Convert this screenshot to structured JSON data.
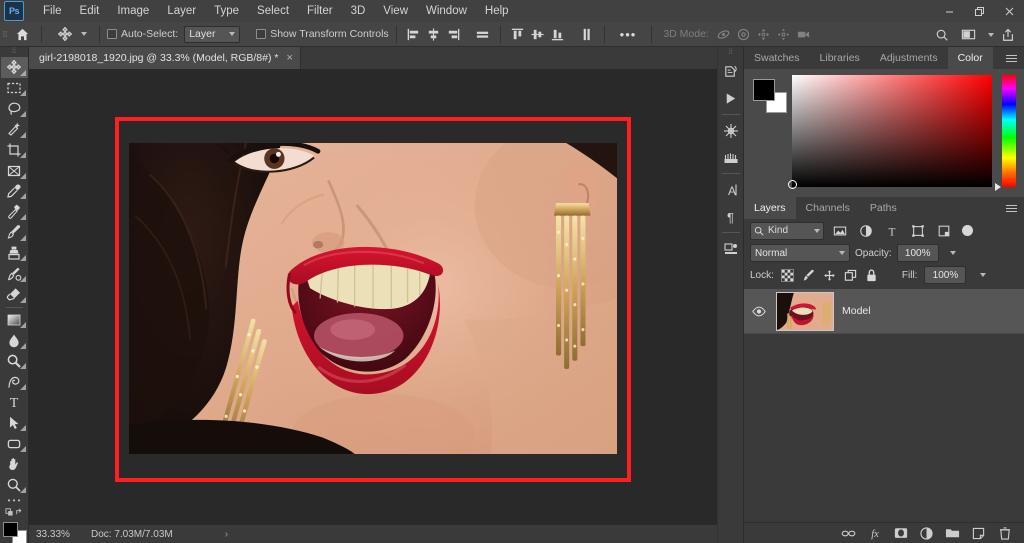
{
  "app": {
    "name": "Adobe Photoshop",
    "logo_text": "Ps",
    "accent_color": "#61b0ef",
    "selection_border_color": "#ff1f22"
  },
  "menubar": {
    "items": [
      {
        "label": "File"
      },
      {
        "label": "Edit"
      },
      {
        "label": "Image"
      },
      {
        "label": "Layer"
      },
      {
        "label": "Type"
      },
      {
        "label": "Select"
      },
      {
        "label": "Filter"
      },
      {
        "label": "3D"
      },
      {
        "label": "View"
      },
      {
        "label": "Window"
      },
      {
        "label": "Help"
      }
    ],
    "window_controls": [
      {
        "name": "minimize",
        "glyph": "—"
      },
      {
        "name": "restore",
        "glyph": "❐"
      },
      {
        "name": "close",
        "glyph": "✕"
      }
    ]
  },
  "options_bar": {
    "home_icon": "home-icon",
    "tool_icon": "move-tool-icon",
    "auto_select_label": "Auto-Select:",
    "auto_select_checked": false,
    "auto_select_scope": "Layer",
    "show_transform_label": "Show Transform Controls",
    "show_transform_checked": false,
    "align_buttons": [
      "align-left-edges",
      "align-horizontal-centers",
      "align-right-edges",
      "distribute-horizontally"
    ],
    "align_buttons_2": [
      "align-top-edges",
      "align-vertical-centers",
      "align-bottom-edges",
      "distribute-vertically"
    ],
    "more_label": "•••",
    "three_d_mode_label": "3D Mode:",
    "three_d_buttons": [
      "orbit-3d",
      "roll-3d",
      "pan-3d",
      "slide-3d",
      "zoom-3d-camera"
    ],
    "right_buttons": [
      "search-icon",
      "workspace-icon",
      "chevron-down-icon",
      "share-icon"
    ]
  },
  "document": {
    "tab_title": "girl-2198018_1920.jpg @ 33.3% (Model, RGB/8#) *",
    "close_glyph": "×"
  },
  "toolbar": {
    "tools": [
      {
        "name": "move-tool",
        "active": true
      },
      {
        "name": "rectangular-marquee-tool",
        "active": false
      },
      {
        "name": "lasso-tool",
        "active": false
      },
      {
        "name": "quick-selection-tool",
        "active": false
      },
      {
        "name": "crop-tool",
        "active": false
      },
      {
        "name": "frame-tool",
        "active": false
      },
      {
        "name": "eyedropper-tool",
        "active": false
      },
      {
        "name": "spot-healing-brush-tool",
        "active": false
      },
      {
        "name": "brush-tool",
        "active": false
      },
      {
        "name": "clone-stamp-tool",
        "active": false
      },
      {
        "name": "history-brush-tool",
        "active": false
      },
      {
        "name": "eraser-tool",
        "active": false
      },
      {
        "name": "gradient-tool",
        "active": false
      },
      {
        "name": "blur-tool",
        "active": false
      },
      {
        "name": "dodge-tool",
        "active": false
      },
      {
        "name": "pen-tool",
        "active": false
      },
      {
        "name": "horizontal-type-tool",
        "active": false
      },
      {
        "name": "path-selection-tool",
        "active": false
      },
      {
        "name": "rectangle-tool",
        "active": false
      },
      {
        "name": "hand-tool",
        "active": false
      },
      {
        "name": "zoom-tool",
        "active": false
      },
      {
        "name": "edit-toolbar-tool",
        "active": false
      }
    ],
    "foreground_color": "#000000",
    "background_color": "#ffffff"
  },
  "icon_dock": {
    "items": [
      {
        "name": "history-panel-icon"
      },
      {
        "name": "actions-panel-icon"
      },
      {
        "name": "adjustments-panel-icon"
      },
      {
        "name": "styles-panel-icon"
      },
      {
        "name": "character-panel-icon",
        "glyph": "A|"
      },
      {
        "name": "paragraph-panel-icon",
        "glyph": "¶"
      },
      {
        "name": "properties-panel-icon"
      }
    ]
  },
  "color_panel": {
    "tabs": [
      {
        "label": "Swatches",
        "active": false
      },
      {
        "label": "Libraries",
        "active": false
      },
      {
        "label": "Adjustments",
        "active": false
      },
      {
        "label": "Color",
        "active": true
      }
    ],
    "foreground_color": "#000000",
    "background_color": "#ffffff",
    "ramp_hue": "#ff0000"
  },
  "layers_panel": {
    "tabs": [
      {
        "label": "Layers",
        "active": true
      },
      {
        "label": "Channels",
        "active": false
      },
      {
        "label": "Paths",
        "active": false
      }
    ],
    "filter": {
      "kind_label": "Kind",
      "icons": [
        "filter-pixel-icon",
        "filter-adjustment-icon",
        "filter-type-icon",
        "filter-shape-icon",
        "filter-smartobject-icon"
      ],
      "toggle_name": "filter-enable-toggle"
    },
    "blend_mode": "Normal",
    "opacity_label": "Opacity:",
    "opacity_value": "100%",
    "lock_label": "Lock:",
    "lock_icons": [
      "lock-transparent-pixels-icon",
      "lock-image-pixels-icon",
      "lock-position-icon",
      "lock-artboard-nesting-icon",
      "lock-all-icon"
    ],
    "fill_label": "Fill:",
    "fill_value": "100%",
    "layers": [
      {
        "name": "Model",
        "visible": true,
        "selected": true
      }
    ],
    "footer_buttons": [
      {
        "name": "link-layers-button",
        "glyph": "∞"
      },
      {
        "name": "layer-style-button",
        "glyph": "fx"
      },
      {
        "name": "layer-mask-button"
      },
      {
        "name": "new-adjustment-layer-button"
      },
      {
        "name": "new-group-button"
      },
      {
        "name": "new-layer-button"
      },
      {
        "name": "delete-layer-button"
      }
    ]
  },
  "status_bar": {
    "zoom": "33.33%",
    "doc_info": "Doc: 7.03M/7.03M",
    "arrow_glyph": "›"
  },
  "canvas": {
    "image_description": "Close-up portrait of smiling woman with red lipstick and gold chandelier earrings",
    "background_color": "#292929"
  }
}
